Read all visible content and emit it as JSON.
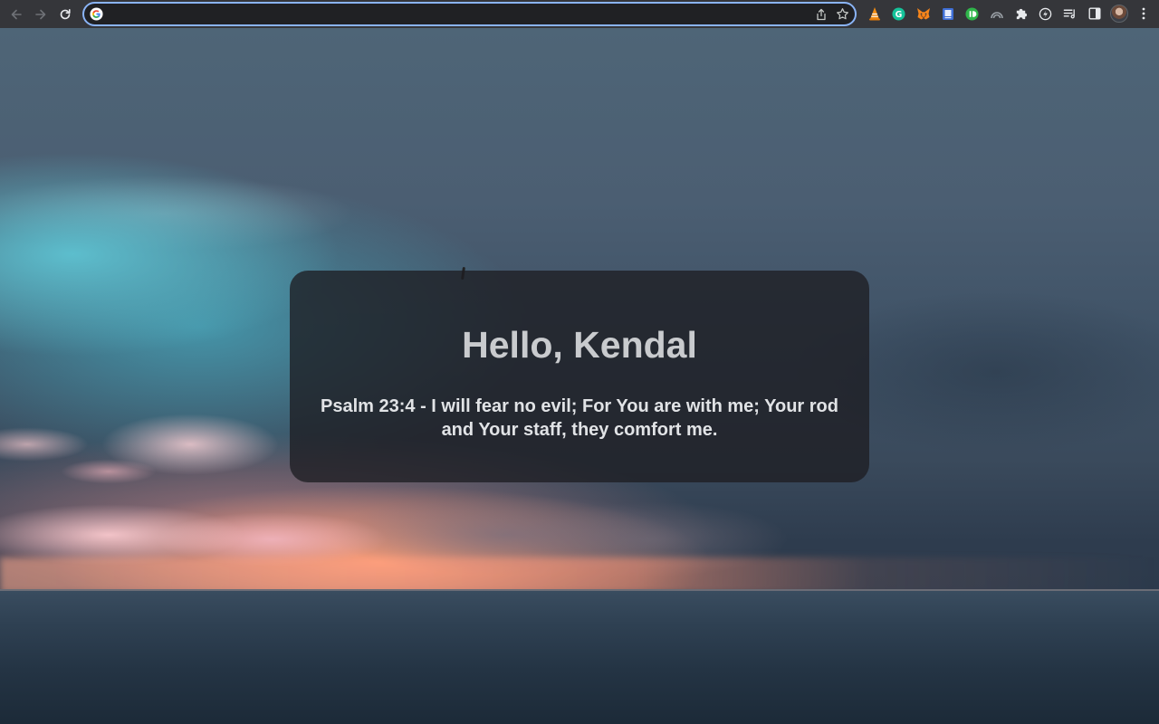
{
  "browser": {
    "toolbar": {
      "back_icon": "arrow-left-icon",
      "forward_icon": "arrow-right-icon",
      "reload_icon": "reload-icon",
      "omnibox": {
        "value": "",
        "provider_icon": "google-g-icon",
        "share_icon": "share-icon",
        "bookmark_icon": "star-icon"
      },
      "extensions": [
        "vlc-cone-icon",
        "grammarly-icon",
        "metamask-fox-icon",
        "book-icon",
        "green-badge-icon",
        "rainbow-icon",
        "puzzle-piece-icon",
        "lightning-circle-icon"
      ],
      "reading_list_icon": "reading-list-icon",
      "side_panel_icon": "side-panel-icon",
      "profile_icon": "avatar",
      "menu_icon": "kebab-menu-icon"
    }
  },
  "page": {
    "greeting": "Hello, Kendal",
    "verse": "Psalm 23:4 - I will fear no evil; For You are with me; Your rod and Your staff, they comfort me."
  },
  "colors": {
    "toolbar_bg": "#35363a",
    "omnibox_border": "#8ab4f8",
    "card_bg": "rgba(30,30,34,0.78)",
    "greeting_text": "#c9cbce",
    "verse_text": "#e1e3e6"
  }
}
